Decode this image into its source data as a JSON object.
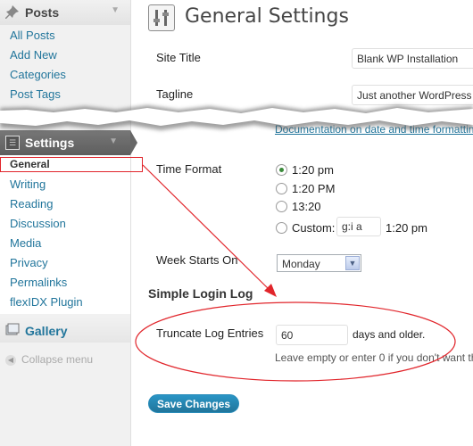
{
  "sidebar": {
    "posts": {
      "label": "Posts",
      "items": [
        {
          "label": "All Posts"
        },
        {
          "label": "Add New"
        },
        {
          "label": "Categories"
        },
        {
          "label": "Post Tags"
        }
      ]
    },
    "settings": {
      "label": "Settings",
      "items": [
        {
          "label": "General"
        },
        {
          "label": "Writing"
        },
        {
          "label": "Reading"
        },
        {
          "label": "Discussion"
        },
        {
          "label": "Media"
        },
        {
          "label": "Privacy"
        },
        {
          "label": "Permalinks"
        },
        {
          "label": "flexIDX Plugin"
        }
      ]
    },
    "gallery": {
      "label": "Gallery"
    },
    "collapse": {
      "label": "Collapse menu"
    }
  },
  "page": {
    "title": "General Settings"
  },
  "form": {
    "site_title": {
      "label": "Site Title",
      "value": "Blank WP Installation"
    },
    "tagline": {
      "label": "Tagline",
      "value": "Just another WordPress"
    },
    "doc_link": "Documentation on date and time formatting",
    "time_format": {
      "label": "Time Format",
      "options": [
        {
          "label": "1:20 pm",
          "checked": true
        },
        {
          "label": "1:20 PM",
          "checked": false
        },
        {
          "label": "13:20",
          "checked": false
        },
        {
          "label": "Custom:",
          "checked": false
        }
      ],
      "custom_value": "g:i a",
      "custom_preview": "1:20 pm"
    },
    "week_starts": {
      "label": "Week Starts On",
      "value": "Monday"
    }
  },
  "simple_login_log": {
    "section_title": "Simple Login Log",
    "truncate": {
      "label": "Truncate Log Entries",
      "value": "60",
      "suffix": "days and older.",
      "help": "Leave empty or enter 0 if you don't want th"
    }
  },
  "save_button": "Save Changes",
  "colors": {
    "link": "#21759b",
    "annotation": "#e1252b",
    "button": "#21759b"
  }
}
